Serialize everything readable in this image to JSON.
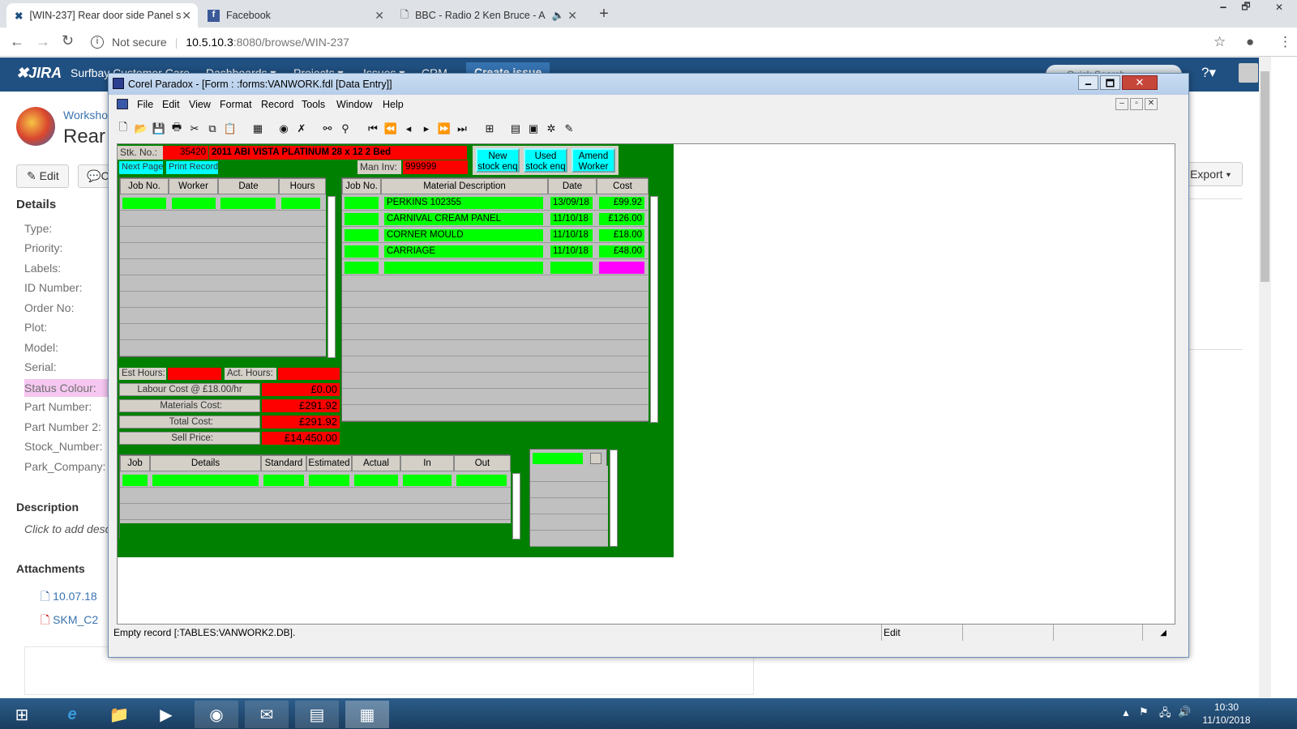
{
  "browser": {
    "tabs": [
      {
        "title": "[WIN-237] Rear door side Panel s"
      },
      {
        "title": "Facebook"
      },
      {
        "title": "BBC - Radio 2 Ken Bruce - A"
      }
    ],
    "security": "Not secure",
    "url_host": "10.5.10.3",
    "url_rest": ":8080/browse/WIN-237"
  },
  "jira": {
    "logo": "JIRA",
    "nav": [
      "Surfbay Customer Care",
      "Dashboards ▾",
      "Projects ▾",
      "Issues ▾",
      "CRM",
      "Create issue"
    ],
    "search_placeholder": "Quick Search",
    "project": "Worksho",
    "issue_title": "Rear",
    "edit": "Edit",
    "comment": "C",
    "export": "Export",
    "details_heading": "Details",
    "fields": [
      "Type:",
      "Priority:",
      "Labels:",
      "ID Number:",
      "Order No:",
      "Plot:",
      "Model:",
      "Serial:",
      "Status Colour:",
      "Part Number:",
      "Part Number 2:",
      "Stock_Number:",
      "Park_Company:"
    ],
    "description_heading": "Description",
    "description_placeholder": "Click to add desc",
    "attachments_heading": "Attachments",
    "attachments": [
      "10.07.18",
      "SKM_C2"
    ]
  },
  "paradox": {
    "title": "Corel Paradox - [Form : :forms:VANWORK.fdl [Data Entry]]",
    "menu": [
      "File",
      "Edit",
      "View",
      "Format",
      "Record",
      "Tools",
      "Window",
      "Help"
    ],
    "stk_label": "Stk. No.:",
    "stk_no": "35420",
    "vehicle": "2011 ABI VISTA PLATINUM 28 x 12 2 Bed",
    "man_inv_label": "Man Inv:",
    "man_inv": "999999",
    "next_page": "Next Page",
    "print_record": "Print Record",
    "btn_new": "New stock enq",
    "btn_used": "Used stock enq",
    "btn_amend": "Amend Worker",
    "labour_headers": [
      "Job No.",
      "Worker",
      "Date",
      "Hours"
    ],
    "material_headers": [
      "Job No.",
      "Material Description",
      "Date",
      "Cost"
    ],
    "materials": [
      {
        "desc": "PERKINS 102355",
        "date": "13/09/18",
        "cost": "£99.92"
      },
      {
        "desc": "CARNIVAL CREAM PANEL",
        "date": "11/10/18",
        "cost": "£126.00"
      },
      {
        "desc": "CORNER MOULD",
        "date": "11/10/18",
        "cost": "£18.00"
      },
      {
        "desc": "CARRIAGE",
        "date": "11/10/18",
        "cost": "£48.00"
      }
    ],
    "est_hours_label": "Est Hours:",
    "act_hours_label": "Act. Hours:",
    "labour_cost_label": "Labour Cost @ £18.00/hr",
    "labour_cost": "£0.00",
    "materials_cost_label": "Materials Cost:",
    "materials_cost": "£291.92",
    "total_cost_label": "Total Cost:",
    "total_cost": "£291.92",
    "sell_price_label": "Sell Price:",
    "sell_price": "£14,450.00",
    "job_headers": [
      "Job",
      "Details",
      "Standard",
      "Estimated",
      "Actual",
      "In",
      "Out"
    ],
    "status_text": "Empty record [:TABLES:VANWORK2.DB].",
    "status_mode": "Edit"
  },
  "taskbar": {
    "time": "10:30",
    "date": "11/10/2018"
  }
}
